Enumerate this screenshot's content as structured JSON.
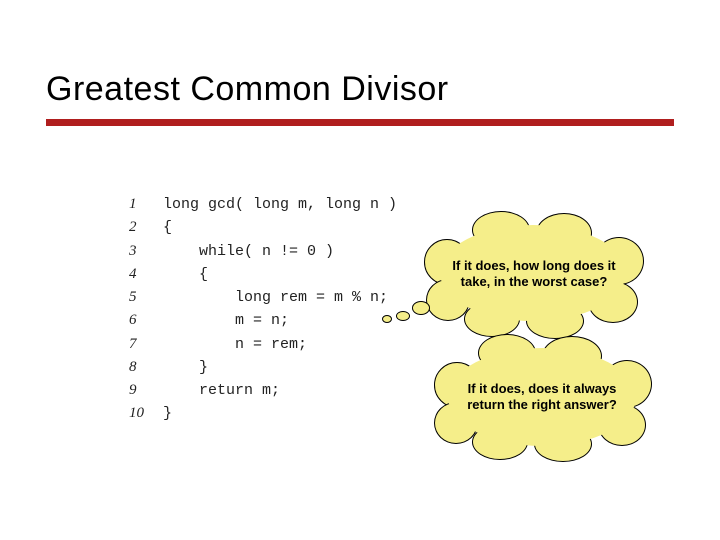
{
  "slide": {
    "title": "Greatest Common Divisor"
  },
  "code": {
    "lines": [
      {
        "n": "1",
        "text": "long gcd( long m, long n )"
      },
      {
        "n": "2",
        "text": "{"
      },
      {
        "n": "3",
        "text": "    while( n != 0 )"
      },
      {
        "n": "4",
        "text": "    {"
      },
      {
        "n": "5",
        "text": "        long rem = m % n;"
      },
      {
        "n": "6",
        "text": "        m = n;"
      },
      {
        "n": "7",
        "text": "        n = rem;"
      },
      {
        "n": "8",
        "text": "    }"
      },
      {
        "n": "9",
        "text": "    return m;"
      },
      {
        "n": "10",
        "text": "}"
      }
    ]
  },
  "clouds": {
    "c1": "If it does, how long does it take, in the worst case?",
    "c2": "If it does, does it always return the right answer?"
  },
  "colors": {
    "rule": "#b01e1e",
    "cloud_fill": "#f5ee8a"
  }
}
